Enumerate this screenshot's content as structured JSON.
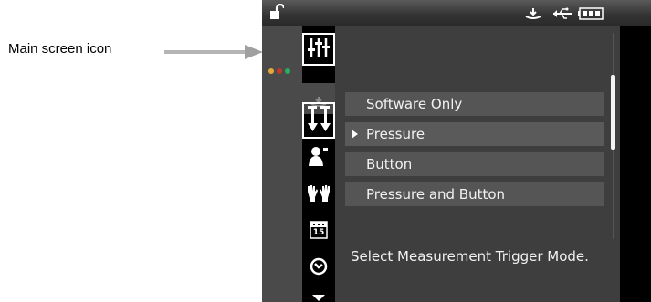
{
  "annotation": {
    "label": "Main screen icon"
  },
  "statusbar": {
    "left_icon": "unlock-icon",
    "right_icons": [
      "calibration-tray-icon",
      "usb-icon",
      "battery-icon"
    ]
  },
  "leftbar": {
    "dots": [
      "#e6a83a",
      "#c0392b",
      "#27ae60"
    ]
  },
  "iconrail": {
    "items": [
      {
        "icon": "sliders-icon",
        "selected": true
      },
      {
        "icon": "calibration-tray-icon",
        "selected": false
      },
      {
        "icon": "measurement-mode-icon",
        "selected": false
      },
      {
        "icon": "user-icon",
        "selected": false
      },
      {
        "icon": "hands-icon",
        "selected": false
      },
      {
        "icon": "calendar-icon",
        "selected": false,
        "text": "15"
      },
      {
        "icon": "gauge-icon",
        "selected": false
      },
      {
        "icon": "chevron-down-icon",
        "selected": false
      }
    ]
  },
  "menu": {
    "items": [
      {
        "label": "Software Only",
        "selected": false
      },
      {
        "label": "Pressure",
        "selected": true
      },
      {
        "label": "Button",
        "selected": false
      },
      {
        "label": "Pressure and Button",
        "selected": false
      }
    ]
  },
  "help_text": "Select Measurement Trigger Mode."
}
